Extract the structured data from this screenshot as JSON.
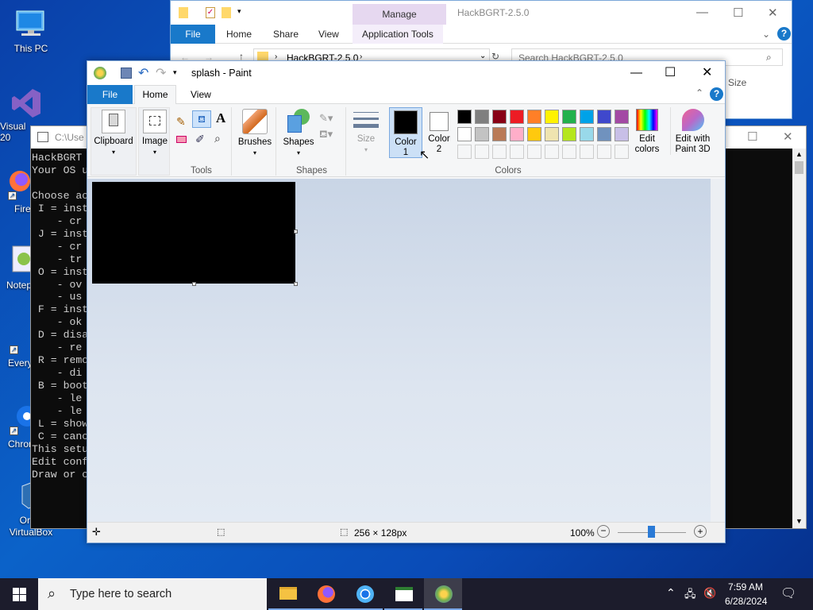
{
  "desktop": {
    "icons": [
      {
        "label": "This PC"
      },
      {
        "label": "Visual\n20"
      },
      {
        "label": "Fire"
      },
      {
        "label": "Notep"
      },
      {
        "label": "Every"
      },
      {
        "label": "Chrom"
      },
      {
        "label": "Oracl\nVirtualBox"
      }
    ]
  },
  "explorer": {
    "manage_label": "Manage",
    "title": "HackBGRT-2.5.0",
    "tabs": [
      "File",
      "Home",
      "Share",
      "View",
      "Application Tools"
    ],
    "address": "HackBGRT-2.5.0",
    "search_placeholder": "Search HackBGRT-2.5.0",
    "column_size": "Size"
  },
  "cmd": {
    "title": "C:\\Use",
    "lines": "HackBGRT\nYour OS u\n\nChoose ac\n I = inst\n    - cr\n J = inst\n    - cr\n    - tr\n O = inst\n    - ov\n    - us\n F = inst\n    - ok\n D = disa\n    - re\n R = remo\n    - di\n B = boot\n    - le\n    - le\n L = show\n C = canc\nThis setu\nEdit conf\nDraw or c"
  },
  "paint": {
    "title": "splash - Paint",
    "tabs": {
      "file": "File",
      "home": "Home",
      "view": "View"
    },
    "groups": {
      "clipboard": "Clipboard",
      "image": "Image",
      "tools": "Tools",
      "brushes": "Brushes",
      "shapes_btn": "Shapes",
      "shapes": "Shapes",
      "size": "Size",
      "color1": "Color\n1",
      "color2": "Color\n2",
      "colors": "Colors",
      "edit_colors": "Edit\ncolors",
      "edit_3d": "Edit with\nPaint 3D"
    },
    "palette_row1": [
      "#000000",
      "#7f7f7f",
      "#880015",
      "#ed1c24",
      "#ff7f27",
      "#fff200",
      "#22b14c",
      "#00a2e8",
      "#3f48cc",
      "#a349a4"
    ],
    "palette_row2": [
      "#ffffff",
      "#c3c3c3",
      "#b97a57",
      "#ffaec9",
      "#ffc90e",
      "#efe4b0",
      "#b5e61d",
      "#99d9ea",
      "#7092be",
      "#c8bfe7"
    ],
    "status": {
      "dimensions": "256 × 128px",
      "zoom": "100%"
    }
  },
  "taskbar": {
    "search_placeholder": "Type here to search",
    "time": "7:59 AM",
    "date": "6/28/2024"
  }
}
